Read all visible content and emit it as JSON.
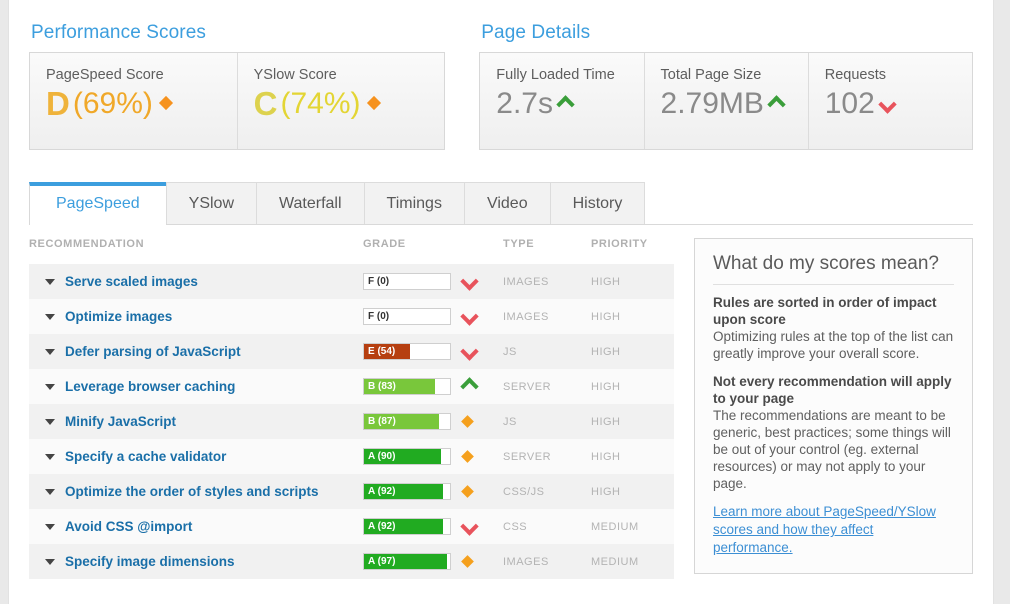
{
  "scores_section": {
    "title": "Performance Scores",
    "items": [
      {
        "label": "PageSpeed Score",
        "letter": "D",
        "percent": "(69%)",
        "indicator": "diamond-icon"
      },
      {
        "label": "YSlow Score",
        "letter": "C",
        "percent": "(74%)",
        "indicator": "diamond-icon"
      }
    ]
  },
  "details_section": {
    "title": "Page Details",
    "items": [
      {
        "label": "Fully Loaded Time",
        "value": "2.7s",
        "indicator": "chevron-up-icon",
        "indicator_color": "#3a9e3a"
      },
      {
        "label": "Total Page Size",
        "value": "2.79MB",
        "indicator": "chevron-up-icon",
        "indicator_color": "#3a9e3a"
      },
      {
        "label": "Requests",
        "value": "102",
        "indicator": "chevron-down-icon",
        "indicator_color": "#e8535c"
      }
    ]
  },
  "tabs": {
    "active": "PageSpeed",
    "items": [
      "PageSpeed",
      "YSlow",
      "Waterfall",
      "Timings",
      "Video",
      "History"
    ]
  },
  "table": {
    "headers": {
      "recommendation": "RECOMMENDATION",
      "grade": "GRADE",
      "type": "TYPE",
      "priority": "PRIORITY"
    },
    "rows": [
      {
        "name": "Serve scaled images",
        "grade": "F",
        "score": 0,
        "grade_text": "F (0)",
        "fill_color": "#ffffff",
        "text_color": "#333333",
        "type": "IMAGES",
        "priority": "HIGH",
        "indicator": "chevron-down-icon",
        "indicator_color": "#e8535c"
      },
      {
        "name": "Optimize images",
        "grade": "F",
        "score": 0,
        "grade_text": "F (0)",
        "fill_color": "#ffffff",
        "text_color": "#333333",
        "type": "IMAGES",
        "priority": "HIGH",
        "indicator": "chevron-down-icon",
        "indicator_color": "#e8535c"
      },
      {
        "name": "Defer parsing of JavaScript",
        "grade": "E",
        "score": 54,
        "grade_text": "E (54)",
        "fill_color": "#b63f10",
        "text_color": "#ffffff",
        "type": "JS",
        "priority": "HIGH",
        "indicator": "chevron-down-icon",
        "indicator_color": "#e8535c"
      },
      {
        "name": "Leverage browser caching",
        "grade": "B",
        "score": 83,
        "grade_text": "B (83)",
        "fill_color": "#79c73b",
        "text_color": "#ffffff",
        "type": "SERVER",
        "priority": "HIGH",
        "indicator": "chevron-up-icon",
        "indicator_color": "#3a9e3a"
      },
      {
        "name": "Minify JavaScript",
        "grade": "B",
        "score": 87,
        "grade_text": "B (87)",
        "fill_color": "#79c73b",
        "text_color": "#ffffff",
        "type": "JS",
        "priority": "HIGH",
        "indicator": "diamond-icon",
        "indicator_color": "#f5a01d"
      },
      {
        "name": "Specify a cache validator",
        "grade": "A",
        "score": 90,
        "grade_text": "A (90)",
        "fill_color": "#21ab21",
        "text_color": "#ffffff",
        "type": "SERVER",
        "priority": "HIGH",
        "indicator": "diamond-icon",
        "indicator_color": "#f5a01d"
      },
      {
        "name": "Optimize the order of styles and scripts",
        "grade": "A",
        "score": 92,
        "grade_text": "A (92)",
        "fill_color": "#21ab21",
        "text_color": "#ffffff",
        "type": "CSS/JS",
        "priority": "HIGH",
        "indicator": "diamond-icon",
        "indicator_color": "#f5a01d"
      },
      {
        "name": "Avoid CSS @import",
        "grade": "A",
        "score": 92,
        "grade_text": "A (92)",
        "fill_color": "#21ab21",
        "text_color": "#ffffff",
        "type": "CSS",
        "priority": "MEDIUM",
        "indicator": "chevron-down-icon",
        "indicator_color": "#e8535c"
      },
      {
        "name": "Specify image dimensions",
        "grade": "A",
        "score": 97,
        "grade_text": "A (97)",
        "fill_color": "#21ab21",
        "text_color": "#ffffff",
        "type": "IMAGES",
        "priority": "MEDIUM",
        "indicator": "diamond-icon",
        "indicator_color": "#f5a01d"
      }
    ]
  },
  "aside": {
    "title": "What do my scores mean?",
    "block1_heading": "Rules are sorted in order of impact upon score",
    "block1_body": "Optimizing rules at the top of the list can greatly improve your overall score.",
    "block2_heading": "Not every recommendation will apply to your page",
    "block2_body": "The recommendations are meant to be generic, best practices; some things will be out of your control (eg. external resources) or may not apply to your page.",
    "link": "Learn more about PageSpeed/YSlow scores and how they affect performance."
  },
  "colors": {
    "accent": "#3c9ede",
    "link": "#1a6fa8",
    "good": "#3a9e3a",
    "bad": "#e8535c",
    "neutral": "#f5a01d"
  }
}
